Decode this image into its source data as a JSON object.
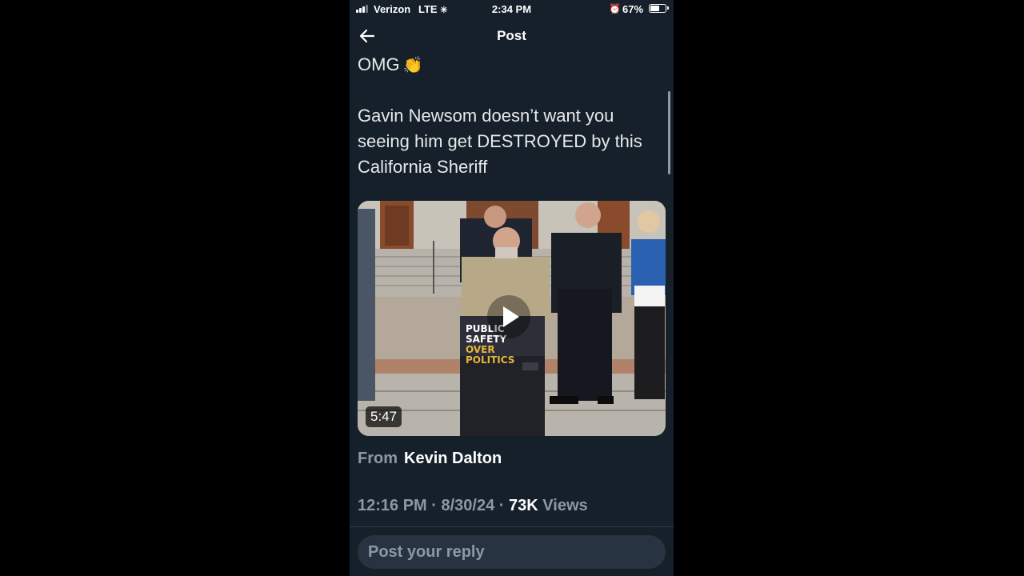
{
  "status_bar": {
    "carrier": "Verizon",
    "network": "LTE",
    "time": "2:34 PM",
    "battery_percent": "67%",
    "battery_level": 0.67,
    "icons": [
      "signal-bars-icon",
      "loading-spinner-icon",
      "alarm-icon",
      "battery-icon"
    ]
  },
  "header": {
    "title": "Post",
    "back_icon": "arrow-left-icon"
  },
  "post": {
    "line1": "OMG",
    "emoji": "👏",
    "body": "Gavin Newsom doesn’t want you seeing him get DESTROYED by this California Sheriff"
  },
  "video": {
    "sign_line1": "PUBLIC SAFETY",
    "sign_line2": "OVER POLITICS",
    "duration": "5:47",
    "play_icon": "play-icon"
  },
  "attribution": {
    "label": "From",
    "name": "Kevin Dalton"
  },
  "meta": {
    "time": "12:16 PM",
    "separator": " · ",
    "date": "8/30/24",
    "views_count": "73K",
    "views_label": "Views"
  },
  "reply": {
    "placeholder": "Post your reply"
  },
  "colors": {
    "background": "#15202b",
    "text": "#e7e9ea",
    "muted": "#8b98a5",
    "reply_box": "#273340",
    "sign_accent": "#e8b63a"
  }
}
